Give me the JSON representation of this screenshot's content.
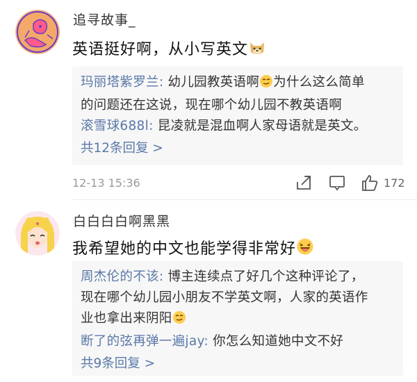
{
  "comments": [
    {
      "username": "追寻故事_",
      "text": "英语挺好啊，从小写英文",
      "text_emoji": "doge-emoji",
      "replies": [
        {
          "author": "玛丽塔紫罗兰",
          "pre_emoji": "幼儿园教英语啊",
          "emoji": "smirk-emoji",
          "post_emoji_line1": "为什么这么简单",
          "line2": "的问题还在这说，现在哪个幼儿园不教英语啊"
        },
        {
          "author": "滚雪球688l",
          "text": "昆凌就是混血啊人家母语就是英文。"
        }
      ],
      "more": "共12条回复 >",
      "time": "12-13 15:36",
      "likes": "172"
    },
    {
      "username": "白白白白啊黑黑",
      "text": "我希望她的中文也能学得非常好",
      "text_emoji": "laugh-emoji",
      "replies": [
        {
          "author": "周杰伦的不该",
          "line1": "博主连续点了好几个这种评论了，",
          "line2": "现在哪个幼儿园小朋友不学英文啊，人家的英语作",
          "line3": "业也拿出来阴阳",
          "emoji": "smirk-emoji"
        },
        {
          "author": "断了的弦再弹一遍jay",
          "text": "你怎么知道她中文不好"
        }
      ],
      "more": "共9条回复 >"
    }
  ],
  "colors": {
    "link": "#5a78a8",
    "reply_bg": "#f7f7f7",
    "meta_text": "#9a9a9a"
  }
}
